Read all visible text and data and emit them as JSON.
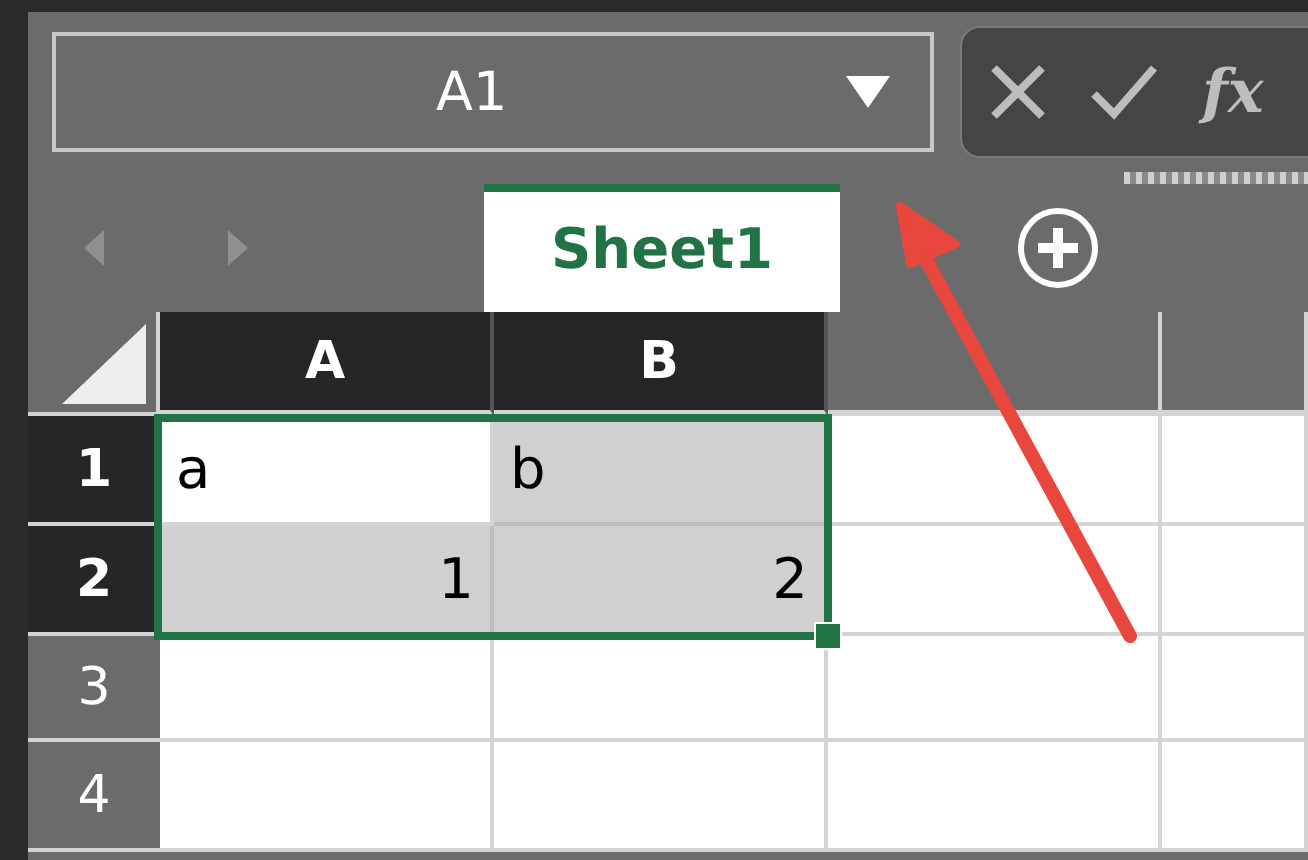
{
  "name_box": {
    "value": "A1"
  },
  "formula_buttons": {
    "function_label": "fx"
  },
  "sheet_tabs": [
    {
      "label": "Sheet1",
      "selected": true
    }
  ],
  "columns": [
    {
      "label": "A",
      "selected": true
    },
    {
      "label": "B",
      "selected": true
    },
    {
      "selected": false
    },
    {
      "selected": false
    }
  ],
  "rows": [
    {
      "label": "1",
      "selected": true,
      "cells": [
        {
          "value": "a",
          "kind": "text",
          "highlighted": false
        },
        {
          "value": "b",
          "kind": "text",
          "highlighted": true
        },
        {
          "highlighted": false
        },
        {
          "highlighted": false
        }
      ]
    },
    {
      "label": "2",
      "selected": true,
      "cells": [
        {
          "value": "1",
          "kind": "number",
          "highlighted": true
        },
        {
          "value": "2",
          "kind": "number",
          "highlighted": true
        },
        {
          "highlighted": false
        },
        {
          "highlighted": false
        }
      ]
    },
    {
      "label": "3",
      "selected": false,
      "cells": [
        {
          "highlighted": false
        },
        {
          "highlighted": false
        },
        {
          "highlighted": false
        },
        {
          "highlighted": false
        }
      ]
    },
    {
      "label": "4",
      "selected": false,
      "cells": [
        {
          "highlighted": false
        },
        {
          "highlighted": false
        },
        {
          "highlighted": false
        },
        {
          "highlighted": false
        }
      ]
    }
  ]
}
